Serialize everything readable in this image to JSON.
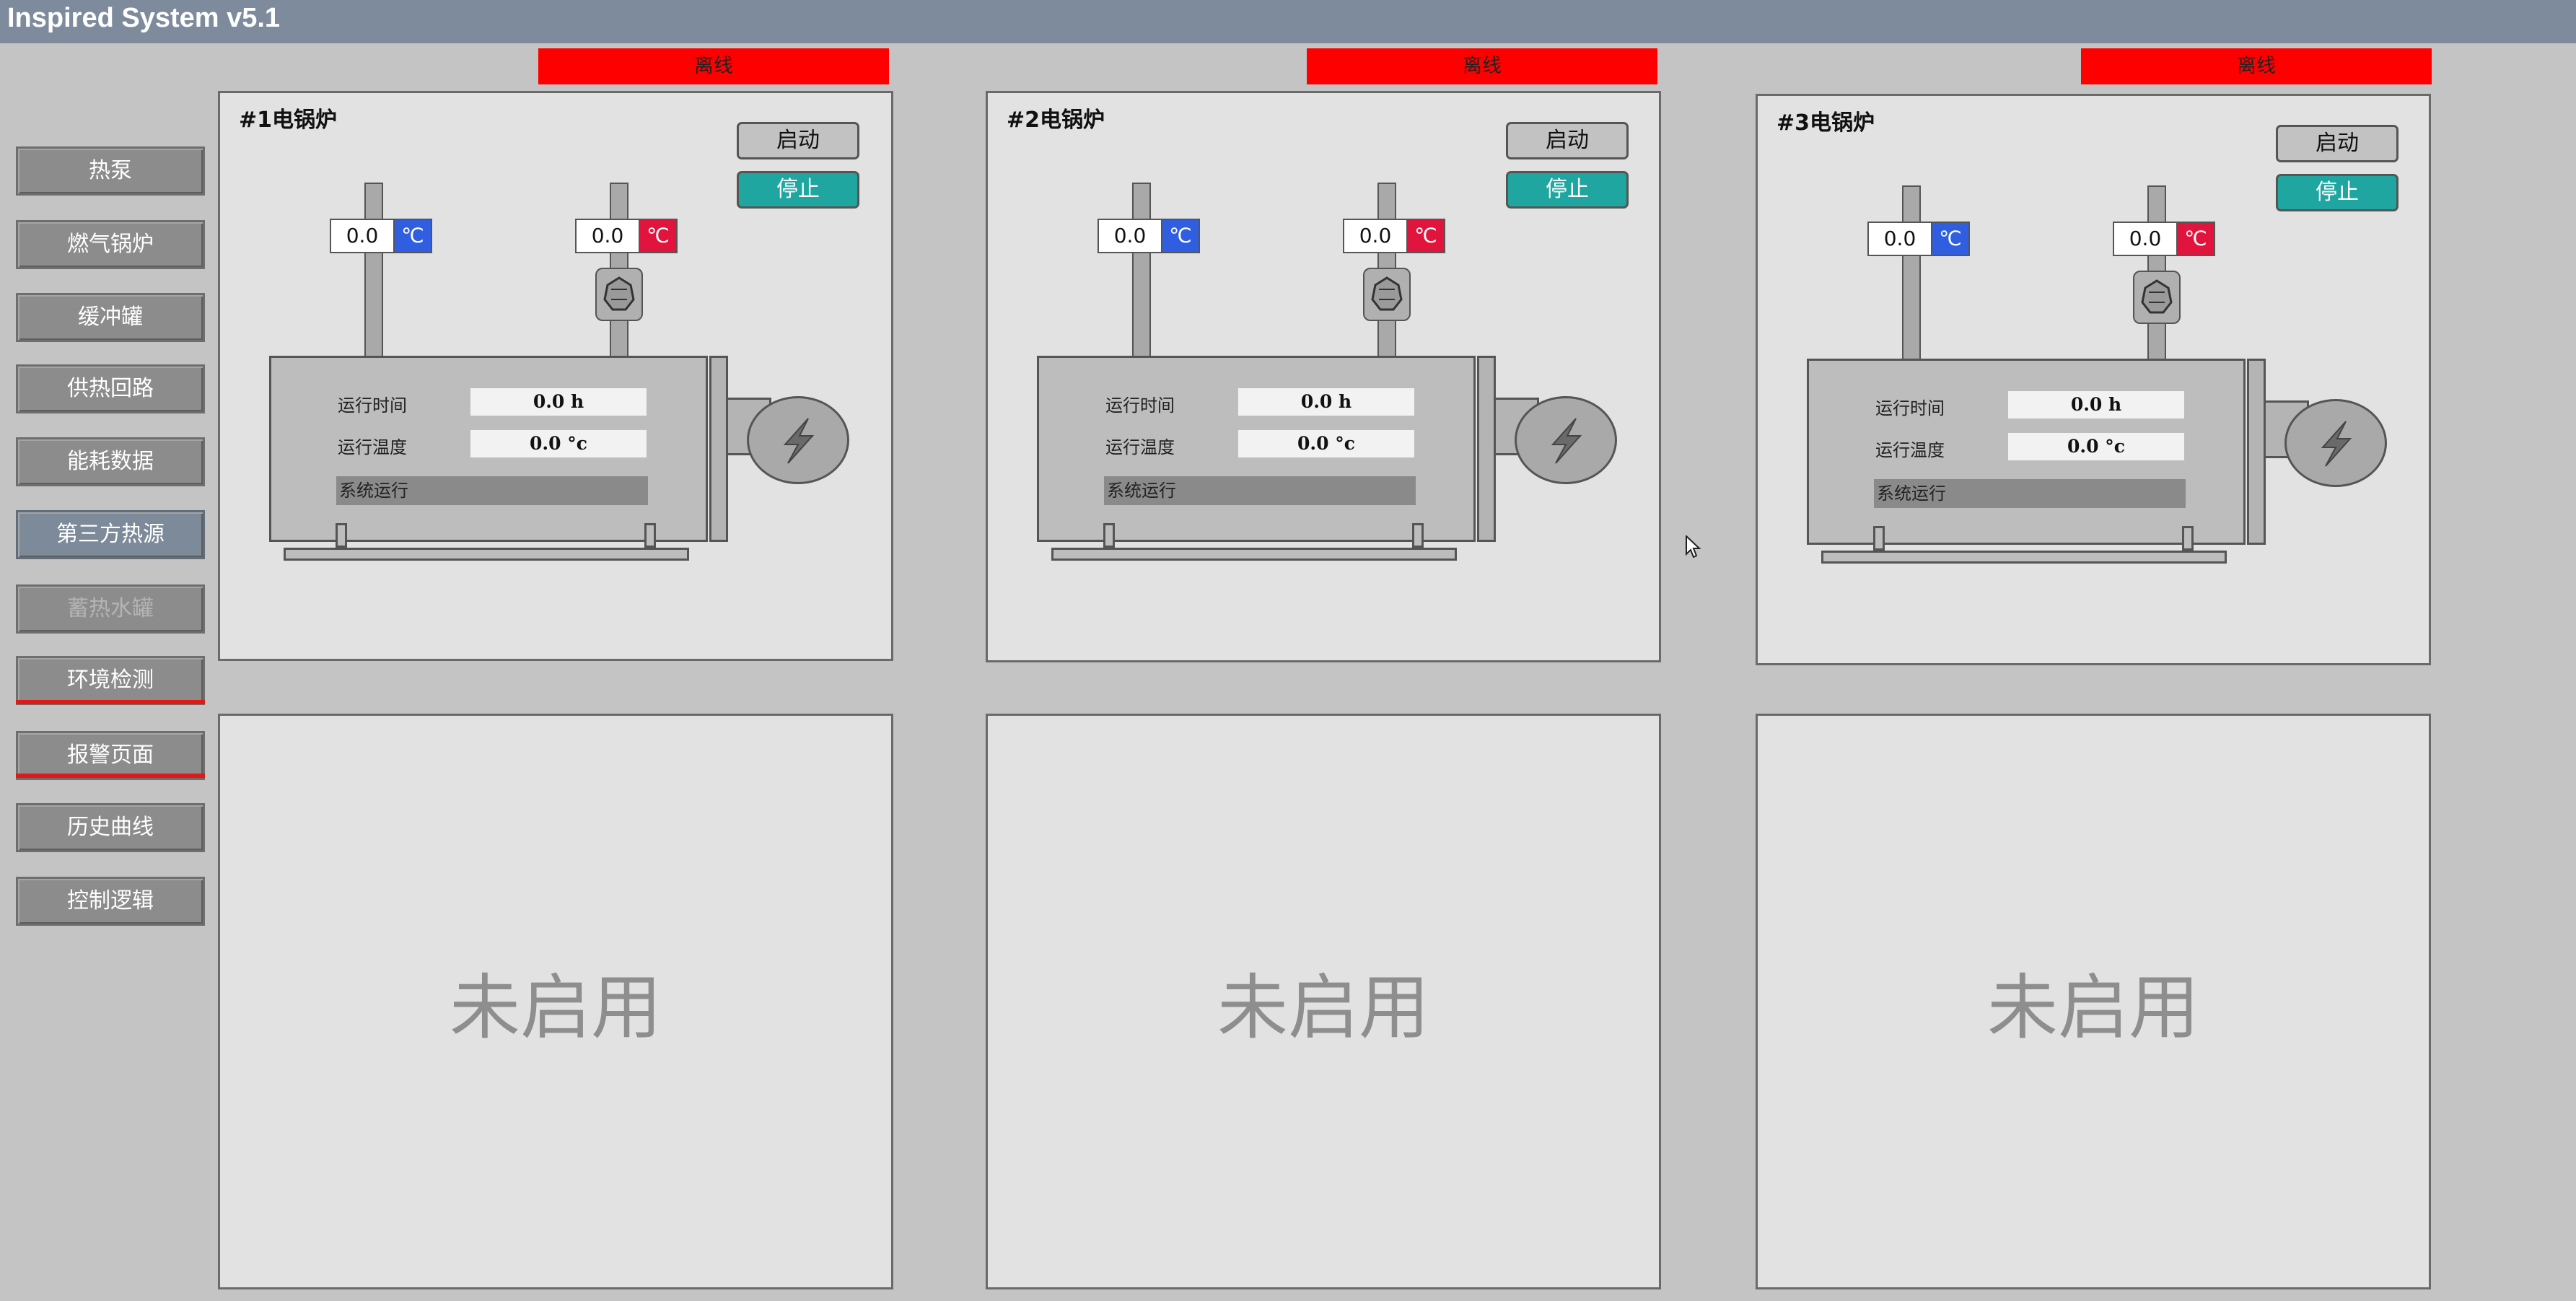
{
  "app": {
    "title": "Inspired System v5.1"
  },
  "sidebar": {
    "items": [
      {
        "label": "热泵"
      },
      {
        "label": "燃气锅炉"
      },
      {
        "label": "缓冲罐"
      },
      {
        "label": "供热回路"
      },
      {
        "label": "能耗数据"
      },
      {
        "label": "第三方热源"
      },
      {
        "label": "蓄热水罐"
      },
      {
        "label": "环境检测"
      },
      {
        "label": "报警页面"
      },
      {
        "label": "历史曲线"
      },
      {
        "label": "控制逻辑"
      }
    ],
    "active_label": "第三方热源",
    "alarm_accent": "#e01818"
  },
  "boilers": [
    {
      "title": "#1电锅炉",
      "status": "离线",
      "start_label": "启动",
      "stop_label": "停止",
      "supply_temp": {
        "value": "0.0",
        "unit": "℃"
      },
      "return_temp": {
        "value": "0.0",
        "unit": "℃"
      },
      "run_time_label": "运行时间",
      "run_time_value": "0.0  h",
      "run_temp_label": "运行温度",
      "run_temp_value": "0.0 °c",
      "system_status": "系统运行"
    },
    {
      "title": "#2电锅炉",
      "status": "离线",
      "start_label": "启动",
      "stop_label": "停止",
      "supply_temp": {
        "value": "0.0",
        "unit": "℃"
      },
      "return_temp": {
        "value": "0.0",
        "unit": "℃"
      },
      "run_time_label": "运行时间",
      "run_time_value": "0.0  h",
      "run_temp_label": "运行温度",
      "run_temp_value": "0.0 °c",
      "system_status": "系统运行"
    },
    {
      "title": "#3电锅炉",
      "status": "离线",
      "start_label": "启动",
      "stop_label": "停止",
      "supply_temp": {
        "value": "0.0",
        "unit": "℃"
      },
      "return_temp": {
        "value": "0.0",
        "unit": "℃"
      },
      "run_time_label": "运行时间",
      "run_time_value": "0.0  h",
      "run_temp_label": "运行温度",
      "run_temp_value": "0.0 °c",
      "system_status": "系统运行"
    }
  ],
  "placeholders": [
    {
      "text": "未启用"
    },
    {
      "text": "未启用"
    },
    {
      "text": "未启用"
    }
  ],
  "colors": {
    "offline_red": "#ff0000",
    "stop_teal": "#1fa6a0",
    "supply_blue": "#2f5fe0",
    "return_red": "#e0143c",
    "titlebar": "#7d8b9c"
  }
}
